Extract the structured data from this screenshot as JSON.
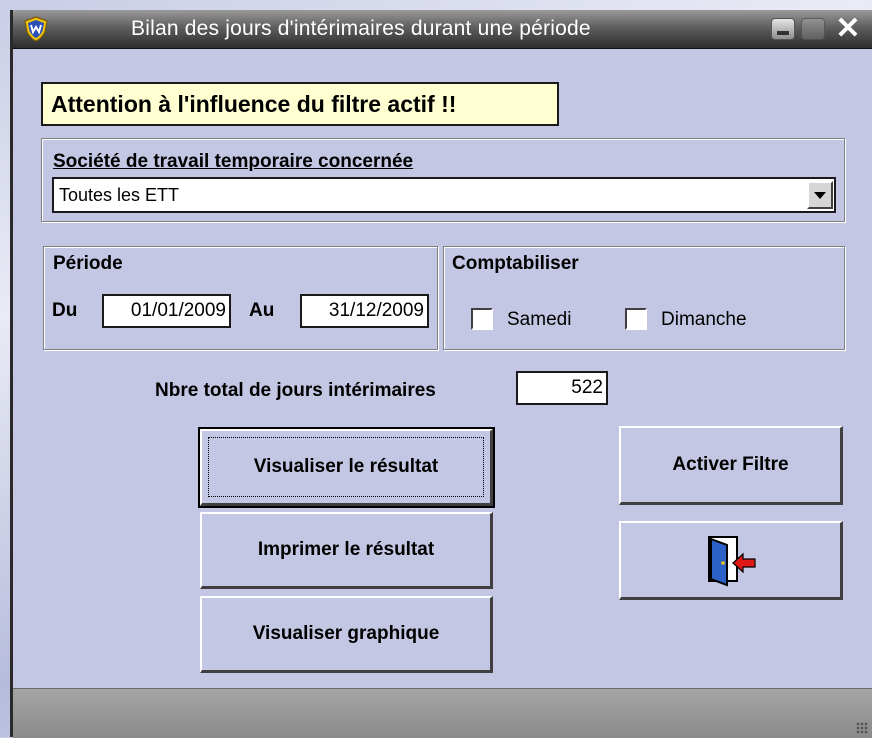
{
  "window": {
    "title": "Bilan des jours d'intérimaires durant une période"
  },
  "warning": "Attention à l'influence du filtre actif !!",
  "ett_group": {
    "label": "Société de travail temporaire concernée",
    "selected": "Toutes les ETT"
  },
  "periode": {
    "label": "Période",
    "du_label": "Du",
    "du_value": "01/01/2009",
    "au_label": "Au",
    "au_value": "31/12/2009"
  },
  "comptabiliser": {
    "label": "Comptabiliser",
    "samedi_label": "Samedi",
    "samedi_checked": false,
    "dimanche_label": "Dimanche",
    "dimanche_checked": false
  },
  "total": {
    "label": "Nbre total de jours intérimaires",
    "value": "522"
  },
  "buttons": {
    "visualiser": "Visualiser le résultat",
    "imprimer": "Imprimer le résultat",
    "graphique": "Visualiser graphique",
    "filtre": "Activer Filtre"
  },
  "icons": {
    "app": "shield-app-icon",
    "exit": "exit-door-icon"
  },
  "colors": {
    "window_bg": "#c4c7e3",
    "warning_bg": "#ffffd2",
    "titlebar": "#2c2c2c"
  }
}
